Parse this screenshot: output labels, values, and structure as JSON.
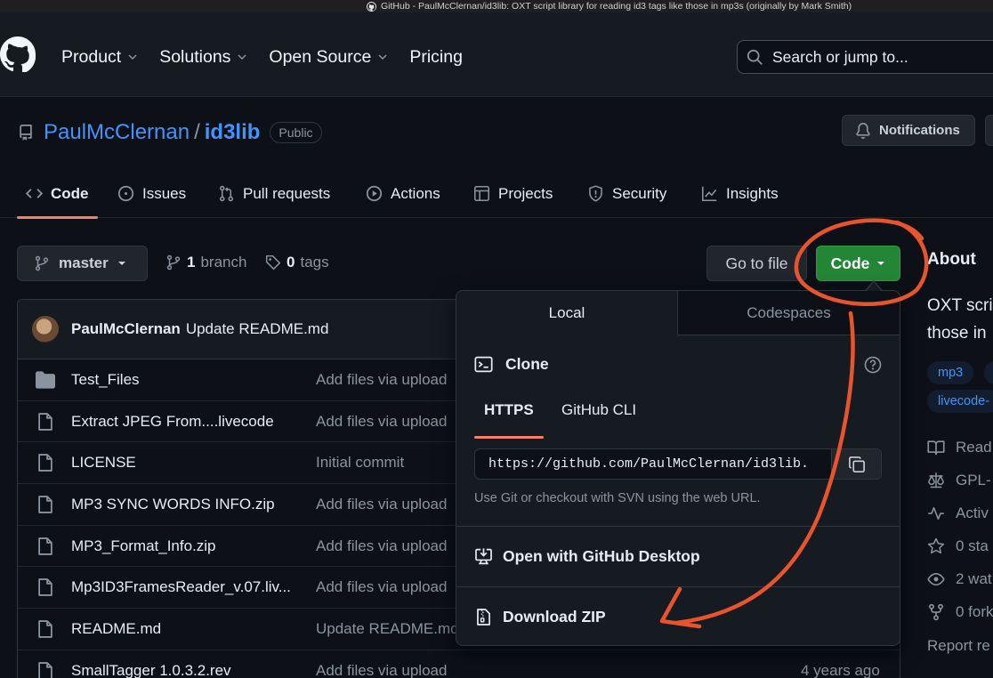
{
  "window": {
    "title": "GitHub - PaulMcClernan/id3lib: OXT script library for reading id3 tags like those in mp3s (originally by Mark Smith)"
  },
  "header": {
    "nav": [
      {
        "label": "Product",
        "has_menu": true
      },
      {
        "label": "Solutions",
        "has_menu": true
      },
      {
        "label": "Open Source",
        "has_menu": true
      },
      {
        "label": "Pricing",
        "has_menu": false
      }
    ],
    "search_placeholder": "Search or jump to..."
  },
  "repo": {
    "owner": "PaulMcClernan",
    "name": "id3lib",
    "visibility": "Public",
    "notifications_label": "Notifications"
  },
  "tabs": [
    {
      "label": "Code",
      "icon": "code-icon",
      "active": true
    },
    {
      "label": "Issues",
      "icon": "issue-icon",
      "active": false
    },
    {
      "label": "Pull requests",
      "icon": "pull-request-icon",
      "active": false
    },
    {
      "label": "Actions",
      "icon": "play-icon",
      "active": false
    },
    {
      "label": "Projects",
      "icon": "table-icon",
      "active": false
    },
    {
      "label": "Security",
      "icon": "shield-icon",
      "active": false
    },
    {
      "label": "Insights",
      "icon": "graph-icon",
      "active": false
    }
  ],
  "branch_bar": {
    "branch": "master",
    "branch_count": "1",
    "branch_word": "branch",
    "tag_count": "0",
    "tag_word": "tags",
    "go_to_file": "Go to file",
    "code_button": "Code"
  },
  "commit": {
    "author": "PaulMcClernan",
    "message": "Update README.md"
  },
  "files": [
    {
      "name": "Test_Files",
      "type": "folder",
      "message": "Add files via upload",
      "age": ""
    },
    {
      "name": "Extract JPEG From....livecode",
      "type": "file",
      "message": "Add files via upload",
      "age": ""
    },
    {
      "name": "LICENSE",
      "type": "file",
      "message": "Initial commit",
      "age": ""
    },
    {
      "name": "MP3 SYNC WORDS INFO.zip",
      "type": "file",
      "message": "Add files via upload",
      "age": ""
    },
    {
      "name": "MP3_Format_Info.zip",
      "type": "file",
      "message": "Add files via upload",
      "age": ""
    },
    {
      "name": "Mp3ID3FramesReader_v.07.liv...",
      "type": "file",
      "message": "Add files via upload",
      "age": ""
    },
    {
      "name": "README.md",
      "type": "file",
      "message": "Update README.md",
      "age": ""
    },
    {
      "name": "SmallTagger 1.0.3.2.rev",
      "type": "file",
      "message": "Add files via upload",
      "age": "4 years ago"
    }
  ],
  "about": {
    "heading": "About",
    "desc_line1": "OXT scri",
    "desc_line2": "those in",
    "topics": [
      "mp3",
      "livecode-"
    ],
    "items": [
      {
        "label": "Read",
        "icon": "book-icon"
      },
      {
        "label": "GPL-",
        "icon": "law-icon"
      },
      {
        "label": "Activ",
        "icon": "pulse-icon"
      },
      {
        "label": "0 sta",
        "icon": "star-icon"
      },
      {
        "label": "2 wat",
        "icon": "eye-icon"
      },
      {
        "label": "0 fork",
        "icon": "fork-icon"
      }
    ],
    "report": "Report re"
  },
  "clone_dropdown": {
    "tab_local": "Local",
    "tab_codespaces": "Codespaces",
    "clone_heading": "Clone",
    "protocol_https": "HTTPS",
    "protocol_cli": "GitHub CLI",
    "url": "https://github.com/PaulMcClernan/id3lib.",
    "hint": "Use Git or checkout with SVN using the web URL.",
    "open_desktop": "Open with GitHub Desktop",
    "download_zip": "Download ZIP"
  },
  "colors": {
    "accent_green": "#238636",
    "link_blue": "#4493f8",
    "tab_underline": "#f78166",
    "annotation": "#e8542c"
  }
}
